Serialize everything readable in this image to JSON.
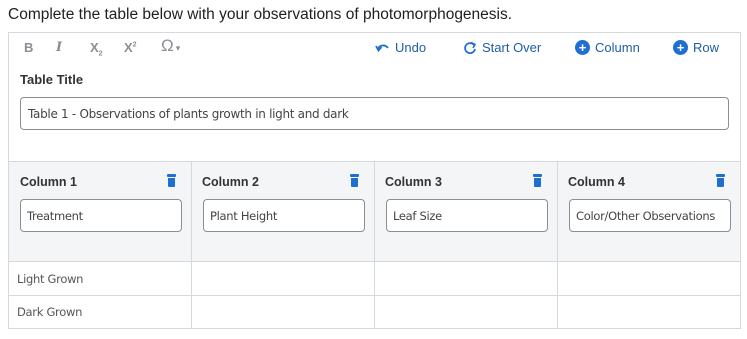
{
  "prompt": "Complete the table below with your observations of photomorphogenesis.",
  "toolbar": {
    "bold": "B",
    "italic": "I",
    "subscript_base": "X",
    "subscript_mark": "2",
    "superscript_base": "X",
    "superscript_mark": "2",
    "symbol": "Ω",
    "symbol_caret": "▾",
    "undo_label": "Undo",
    "start_over_label": "Start Over",
    "add_column_label": "Column",
    "add_row_label": "Row"
  },
  "table_title": {
    "label": "Table Title",
    "value": "Table 1 - Observations of plants growth in light and dark"
  },
  "columns": [
    {
      "label": "Column 1",
      "value": "Treatment"
    },
    {
      "label": "Column 2",
      "value": "Plant Height"
    },
    {
      "label": "Column 3",
      "value": "Leaf Size"
    },
    {
      "label": "Column 4",
      "value": "Color/Other Observations"
    }
  ],
  "rows": [
    {
      "label": "Light Grown"
    },
    {
      "label": "Dark Grown"
    }
  ],
  "colors": {
    "accent": "#1f6fd1",
    "link": "#1f5fa8",
    "border": "#d6d9dc",
    "header_bg": "#f4f5f6"
  }
}
